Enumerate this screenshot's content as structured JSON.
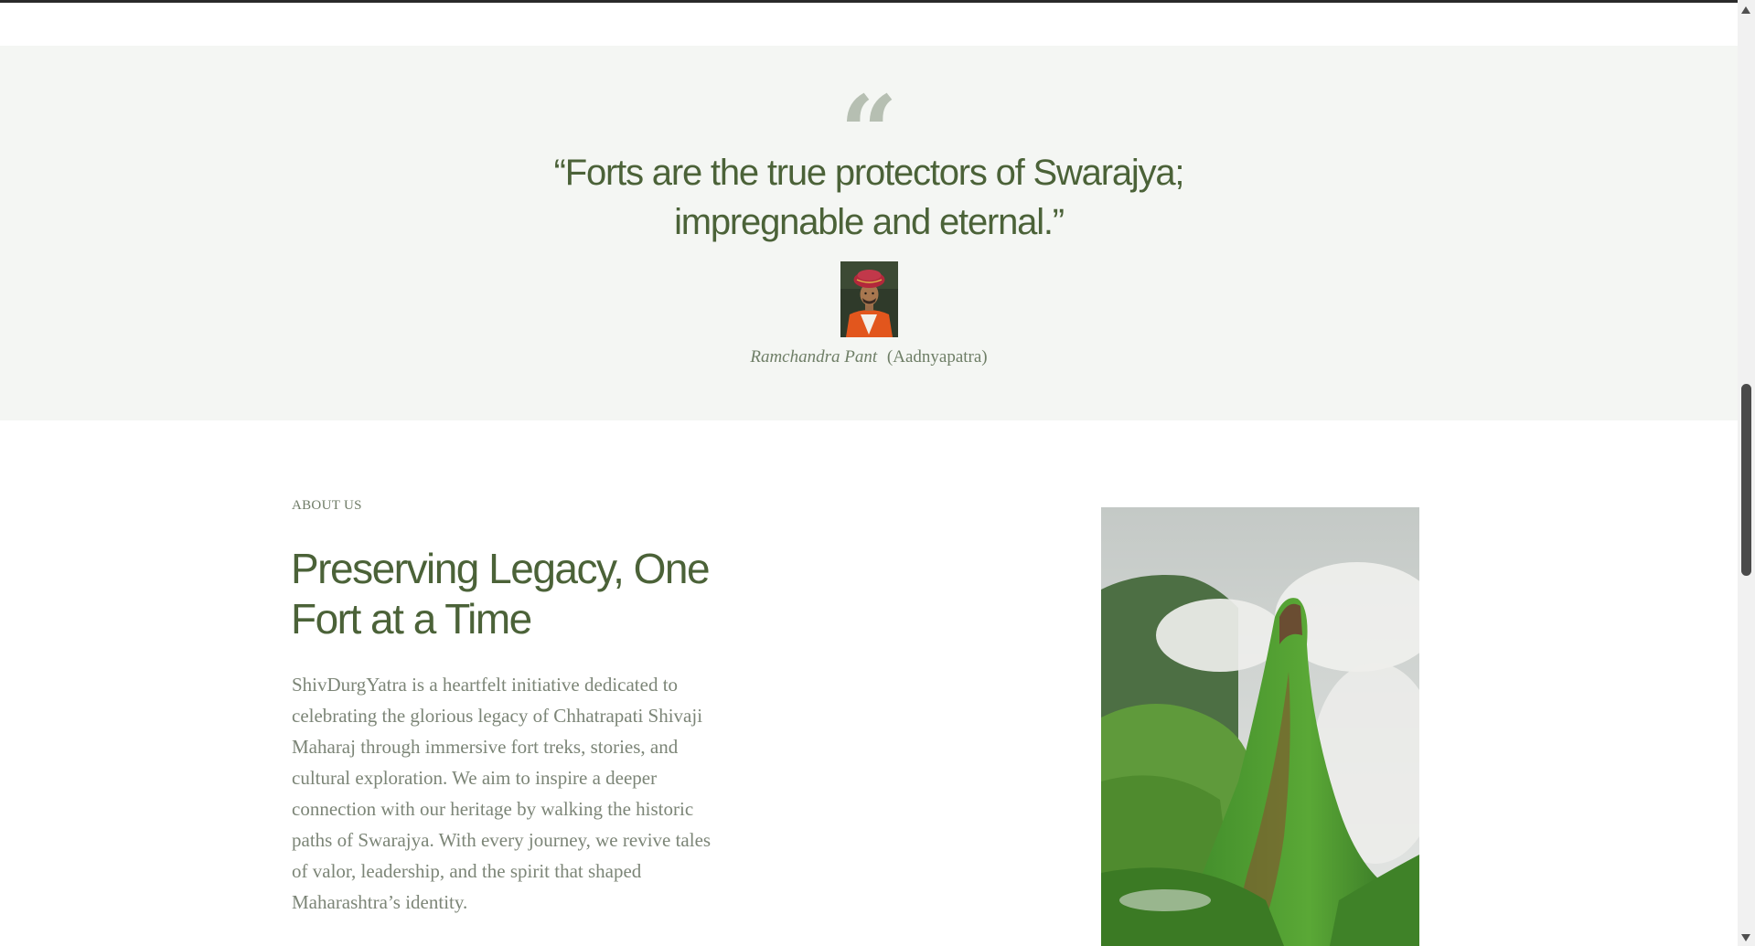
{
  "quote": {
    "mark": "“",
    "text": "“Forts are the true protectors of Swarajya; impregnable and eternal.”",
    "author": "Ramchandra Pant",
    "source": "(Aadnyapatra)"
  },
  "about": {
    "eyebrow": "ABOUT US",
    "title": "Preserving Legacy, One Fort at a Time",
    "body": "ShivDurgYatra is a heartfelt initiative dedicated to celebrating the glorious legacy of Chhatrapati Shivaji Maharaj through immersive fort treks, stories, and cultural exploration. We aim to inspire a deeper connection with our heritage by walking the historic paths of Swarajya. With every journey, we revive tales of valor, leadership, and the spirit that shaped Maharashtra’s identity."
  },
  "colors": {
    "accent": "#4b6238",
    "quote_bg": "#f4f6f3",
    "body_text": "#7c8577"
  }
}
